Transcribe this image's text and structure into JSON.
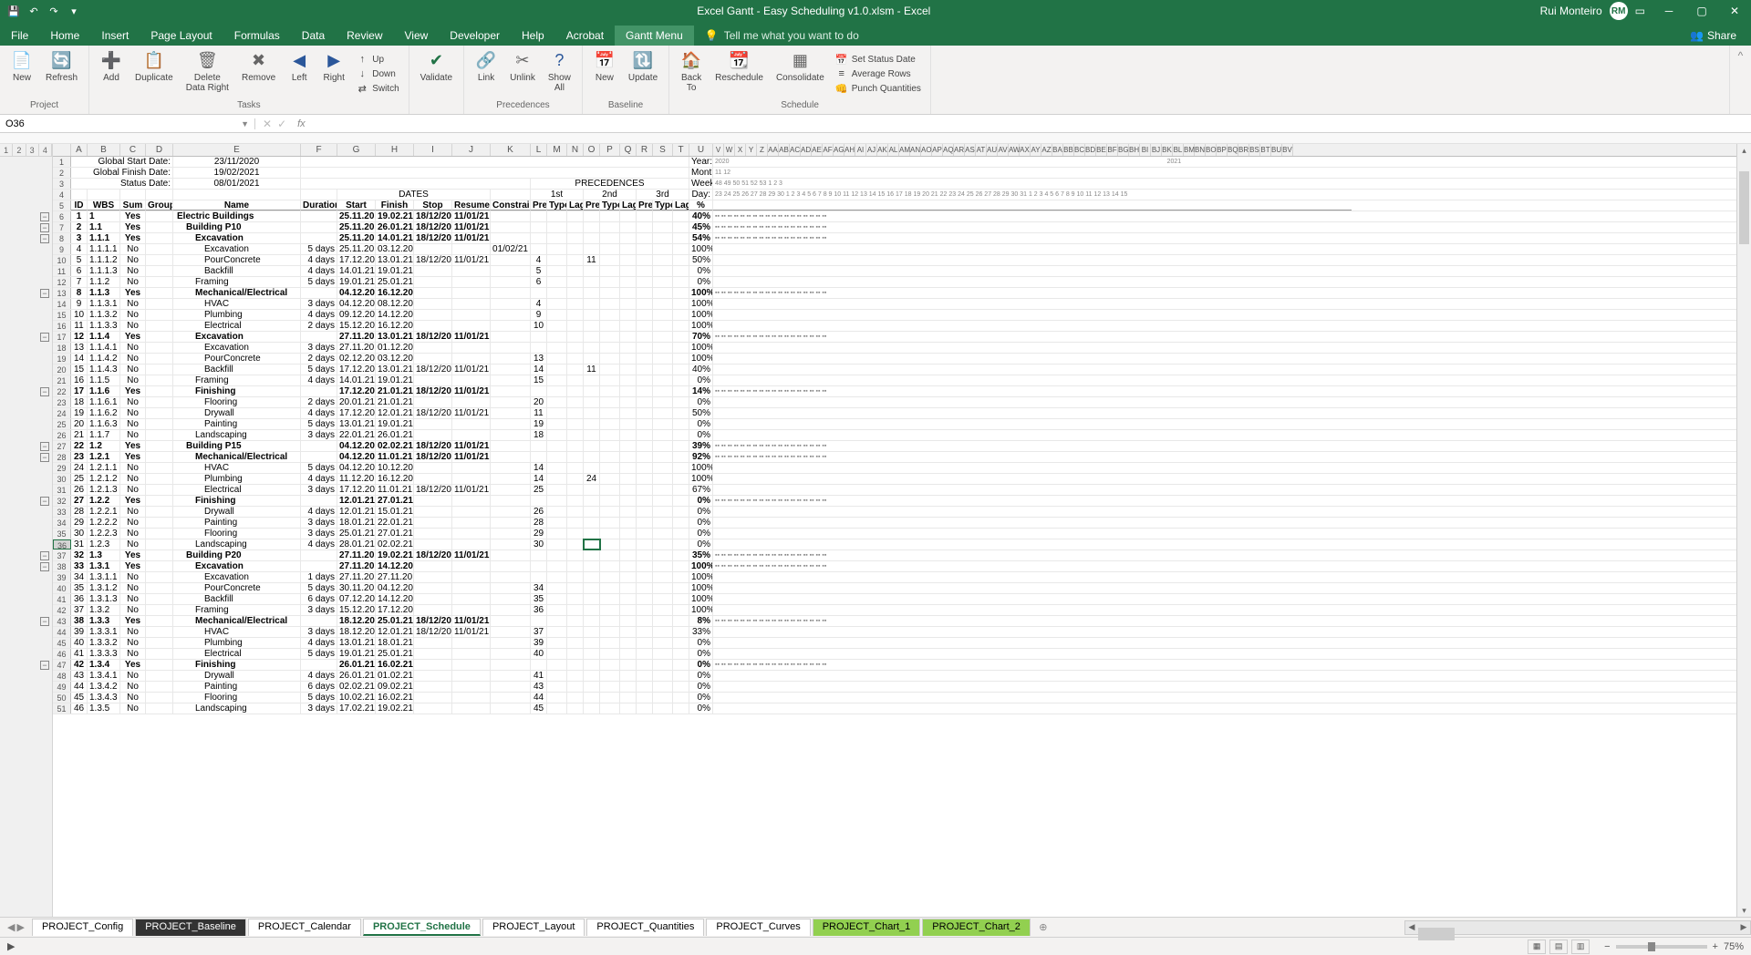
{
  "title": "Excel Gantt - Easy Scheduling v1.0.xlsm - Excel",
  "user": "Rui Monteiro",
  "tabs": [
    "File",
    "Home",
    "Insert",
    "Page Layout",
    "Formulas",
    "Data",
    "Review",
    "View",
    "Developer",
    "Help",
    "Acrobat",
    "Gantt Menu"
  ],
  "active_tab": "Gantt Menu",
  "tellme": "Tell me what you want to do",
  "share": "Share",
  "ribbon": {
    "groups": [
      {
        "name": "Project",
        "buttons": [
          {
            "icon": "📄",
            "label": "New"
          },
          {
            "icon": "🔄",
            "label": "Refresh",
            "color": "#217346"
          }
        ]
      },
      {
        "name": "Tasks",
        "buttons": [
          {
            "icon": "➕",
            "label": "Add"
          },
          {
            "icon": "📋",
            "label": "Duplicate"
          },
          {
            "icon": "🗑",
            "label": "Delete\nData Right"
          },
          {
            "icon": "✖",
            "label": "Remove"
          },
          {
            "icon": "◀",
            "label": "Left",
            "color": "#2b579a"
          },
          {
            "icon": "▶",
            "label": "Right",
            "color": "#2b579a"
          }
        ],
        "side": [
          {
            "icon": "↑",
            "label": "Up"
          },
          {
            "icon": "↓",
            "label": "Down"
          },
          {
            "icon": "⇄",
            "label": "Switch"
          }
        ]
      },
      {
        "name": "",
        "buttons": [
          {
            "icon": "✔",
            "label": "Validate",
            "color": "#217346"
          }
        ]
      },
      {
        "name": "Precedences",
        "buttons": [
          {
            "icon": "🔗",
            "label": "Link"
          },
          {
            "icon": "✂",
            "label": "Unlink"
          },
          {
            "icon": "?",
            "label": "Show\nAll",
            "color": "#2b579a"
          }
        ]
      },
      {
        "name": "Baseline",
        "buttons": [
          {
            "icon": "📅",
            "label": "New"
          },
          {
            "icon": "🔃",
            "label": "Update"
          }
        ]
      },
      {
        "name": "Schedule",
        "buttons": [
          {
            "icon": "🏠",
            "label": "Back\nTo"
          },
          {
            "icon": "📆",
            "label": "Reschedule"
          },
          {
            "icon": "▦",
            "label": "Consolidate"
          }
        ],
        "side": [
          {
            "icon": "📅",
            "label": "Set Status Date"
          },
          {
            "icon": "≡",
            "label": "Average Rows"
          },
          {
            "icon": "👊",
            "label": "Punch Quantities"
          }
        ]
      }
    ]
  },
  "namebox": "O36",
  "meta": {
    "global_start_label": "Global Start Date:",
    "global_start": "23/11/2020",
    "global_finish_label": "Global Finish Date:",
    "global_finish": "19/02/2021",
    "status_label": "Status Date:",
    "status": "08/01/2021",
    "year_label": "Year:",
    "year": "2020",
    "year2": "2021",
    "month_label": "Month:",
    "month": "11",
    "week_label": "Week:",
    "week": "48",
    "day_label": "Day:"
  },
  "col_hdrs": [
    "A",
    "B",
    "C",
    "D",
    "E",
    "F",
    "G",
    "H",
    "I",
    "J",
    "K",
    "L",
    "M",
    "N",
    "O",
    "P",
    "Q",
    "R",
    "S",
    "T",
    "U"
  ],
  "gantt_hdrs": [
    "V",
    "W",
    "X",
    "Y",
    "Z",
    "AA",
    "AB",
    "AC",
    "AD",
    "AE",
    "AF",
    "AG",
    "AH",
    "AI",
    "AJ",
    "AK",
    "AL",
    "AM",
    "AN",
    "AO",
    "AP",
    "AQ",
    "AR",
    "AS",
    "AT",
    "AU",
    "AV",
    "AW",
    "AX",
    "AY",
    "AZ",
    "BA",
    "BB",
    "BC",
    "BD",
    "BE",
    "BF",
    "BG",
    "BH",
    "BI",
    "BJ",
    "BK",
    "BL",
    "BM",
    "BN",
    "BO",
    "BP",
    "BQ",
    "BR",
    "BS",
    "BT",
    "BU",
    "BV"
  ],
  "headers": {
    "dates": "DATES",
    "prec": "PRECEDENCES",
    "id": "ID",
    "wbs": "WBS",
    "sum": "Sum",
    "group": "Group",
    "name": "Name",
    "duration": "Duration",
    "start": "Start",
    "finish": "Finish",
    "stop": "Stop",
    "resume": "Resume",
    "constraint": "Constraint",
    "pre": "Pre",
    "type": "Type",
    "lag": "Lag",
    "first": "1st",
    "second": "2nd",
    "third": "3rd",
    "pct": "%"
  },
  "weeks": [
    "48",
    "",
    "",
    "",
    "",
    "",
    "",
    "49",
    "",
    "",
    "",
    "",
    "",
    "",
    "50",
    "",
    "",
    "",
    "",
    "",
    "",
    "51",
    "",
    "",
    "",
    "",
    "",
    "",
    "52",
    "",
    "",
    "",
    "",
    "",
    "",
    "53",
    "",
    "",
    "",
    "",
    "",
    "",
    "1",
    "",
    "",
    "",
    "",
    "",
    "",
    "2",
    "",
    "",
    "",
    "",
    "",
    "",
    "3",
    ""
  ],
  "days": [
    "23",
    "24",
    "25",
    "26",
    "27",
    "28",
    "29",
    "30",
    "1",
    "2",
    "3",
    "4",
    "5",
    "6",
    "7",
    "8",
    "9",
    "10",
    "11",
    "12",
    "13",
    "14",
    "15",
    "16",
    "17",
    "18",
    "19",
    "20",
    "21",
    "22",
    "23",
    "24",
    "25",
    "26",
    "27",
    "28",
    "29",
    "30",
    "31",
    "1",
    "2",
    "3",
    "4",
    "5",
    "6",
    "7",
    "8",
    "9",
    "10",
    "11",
    "12",
    "13",
    "14",
    "15"
  ],
  "rows": [
    {
      "n": 6,
      "id": "1",
      "wbs": "1",
      "sum": "Yes",
      "name": "Electric Buildings",
      "b": 1,
      "start": "25.11.20",
      "finish": "19.02.21",
      "stop": "18/12/20",
      "resume": "11/01/21",
      "pct": "40%"
    },
    {
      "n": 7,
      "id": "2",
      "wbs": "1.1",
      "sum": "Yes",
      "name": "Building P10",
      "b": 1,
      "start": "25.11.20",
      "finish": "26.01.21",
      "stop": "18/12/20",
      "resume": "11/01/21",
      "pct": "45%"
    },
    {
      "n": 8,
      "id": "3",
      "wbs": "1.1.1",
      "sum": "Yes",
      "name": "Excavation",
      "b": 1,
      "start": "25.11.20",
      "finish": "14.01.21",
      "stop": "18/12/20",
      "resume": "11/01/21",
      "pct": "54%"
    },
    {
      "n": 9,
      "id": "4",
      "wbs": "1.1.1.1",
      "sum": "No",
      "name": "Excavation",
      "dur": "5 days",
      "start": "25.11.20",
      "finish": "03.12.20",
      "constraint": "01/02/21",
      "pct": "100%"
    },
    {
      "n": 10,
      "id": "5",
      "wbs": "1.1.1.2",
      "sum": "No",
      "name": "PourConcrete",
      "dur": "4 days",
      "start": "17.12.20",
      "finish": "13.01.21",
      "stop": "18/12/20",
      "resume": "11/01/21",
      "p1": "4",
      "p2": "11",
      "pct": "50%"
    },
    {
      "n": 11,
      "id": "6",
      "wbs": "1.1.1.3",
      "sum": "No",
      "name": "Backfill",
      "dur": "4 days",
      "start": "14.01.21",
      "finish": "19.01.21",
      "p1": "5",
      "pct": "0%"
    },
    {
      "n": 12,
      "id": "7",
      "wbs": "1.1.2",
      "sum": "No",
      "name": "Framing",
      "dur": "5 days",
      "start": "19.01.21",
      "finish": "25.01.21",
      "p1": "6",
      "pct": "0%"
    },
    {
      "n": 13,
      "id": "8",
      "wbs": "1.1.3",
      "sum": "Yes",
      "name": "Mechanical/Electrical",
      "b": 1,
      "start": "04.12.20",
      "finish": "16.12.20",
      "pct": "100%"
    },
    {
      "n": 14,
      "id": "9",
      "wbs": "1.1.3.1",
      "sum": "No",
      "name": "HVAC",
      "dur": "3 days",
      "start": "04.12.20",
      "finish": "08.12.20",
      "p1": "4",
      "pct": "100%"
    },
    {
      "n": 15,
      "id": "10",
      "wbs": "1.1.3.2",
      "sum": "No",
      "name": "Plumbing",
      "dur": "4 days",
      "start": "09.12.20",
      "finish": "14.12.20",
      "p1": "9",
      "pct": "100%"
    },
    {
      "n": 16,
      "id": "11",
      "wbs": "1.1.3.3",
      "sum": "No",
      "name": "Electrical",
      "dur": "2 days",
      "start": "15.12.20",
      "finish": "16.12.20",
      "p1": "10",
      "pct": "100%"
    },
    {
      "n": 17,
      "id": "12",
      "wbs": "1.1.4",
      "sum": "Yes",
      "name": "Excavation",
      "b": 1,
      "start": "27.11.20",
      "finish": "13.01.21",
      "stop": "18/12/20",
      "resume": "11/01/21",
      "pct": "70%"
    },
    {
      "n": 18,
      "id": "13",
      "wbs": "1.1.4.1",
      "sum": "No",
      "name": "Excavation",
      "dur": "3 days",
      "start": "27.11.20",
      "finish": "01.12.20",
      "pct": "100%"
    },
    {
      "n": 19,
      "id": "14",
      "wbs": "1.1.4.2",
      "sum": "No",
      "name": "PourConcrete",
      "dur": "2 days",
      "start": "02.12.20",
      "finish": "03.12.20",
      "p1": "13",
      "pct": "100%"
    },
    {
      "n": 20,
      "id": "15",
      "wbs": "1.1.4.3",
      "sum": "No",
      "name": "Backfill",
      "dur": "5 days",
      "start": "17.12.20",
      "finish": "13.01.21",
      "stop": "18/12/20",
      "resume": "11/01/21",
      "p1": "14",
      "p2": "11",
      "pct": "40%"
    },
    {
      "n": 21,
      "id": "16",
      "wbs": "1.1.5",
      "sum": "No",
      "name": "Framing",
      "dur": "4 days",
      "start": "14.01.21",
      "finish": "19.01.21",
      "p1": "15",
      "pct": "0%"
    },
    {
      "n": 22,
      "id": "17",
      "wbs": "1.1.6",
      "sum": "Yes",
      "name": "Finishing",
      "b": 1,
      "start": "17.12.20",
      "finish": "21.01.21",
      "stop": "18/12/20",
      "resume": "11/01/21",
      "pct": "14%"
    },
    {
      "n": 23,
      "id": "18",
      "wbs": "1.1.6.1",
      "sum": "No",
      "name": "Flooring",
      "dur": "2 days",
      "start": "20.01.21",
      "finish": "21.01.21",
      "p1": "20",
      "pct": "0%"
    },
    {
      "n": 24,
      "id": "19",
      "wbs": "1.1.6.2",
      "sum": "No",
      "name": "Drywall",
      "dur": "4 days",
      "start": "17.12.20",
      "finish": "12.01.21",
      "stop": "18/12/20",
      "resume": "11/01/21",
      "p1": "11",
      "pct": "50%"
    },
    {
      "n": 25,
      "id": "20",
      "wbs": "1.1.6.3",
      "sum": "No",
      "name": "Painting",
      "dur": "5 days",
      "start": "13.01.21",
      "finish": "19.01.21",
      "p1": "19",
      "pct": "0%"
    },
    {
      "n": 26,
      "id": "21",
      "wbs": "1.1.7",
      "sum": "No",
      "name": "Landscaping",
      "dur": "3 days",
      "start": "22.01.21",
      "finish": "26.01.21",
      "p1": "18",
      "pct": "0%"
    },
    {
      "n": 27,
      "id": "22",
      "wbs": "1.2",
      "sum": "Yes",
      "name": "Building P15",
      "b": 1,
      "start": "04.12.20",
      "finish": "02.02.21",
      "stop": "18/12/20",
      "resume": "11/01/21",
      "pct": "39%"
    },
    {
      "n": 28,
      "id": "23",
      "wbs": "1.2.1",
      "sum": "Yes",
      "name": "Mechanical/Electrical",
      "b": 1,
      "start": "04.12.20",
      "finish": "11.01.21",
      "stop": "18/12/20",
      "resume": "11/01/21",
      "pct": "92%"
    },
    {
      "n": 29,
      "id": "24",
      "wbs": "1.2.1.1",
      "sum": "No",
      "name": "HVAC",
      "dur": "5 days",
      "start": "04.12.20",
      "finish": "10.12.20",
      "p1": "14",
      "pct": "100%"
    },
    {
      "n": 30,
      "id": "25",
      "wbs": "1.2.1.2",
      "sum": "No",
      "name": "Plumbing",
      "dur": "4 days",
      "start": "11.12.20",
      "finish": "16.12.20",
      "p1": "14",
      "p2": "24",
      "pct": "100%"
    },
    {
      "n": 31,
      "id": "26",
      "wbs": "1.2.1.3",
      "sum": "No",
      "name": "Electrical",
      "dur": "3 days",
      "start": "17.12.20",
      "finish": "11.01.21",
      "stop": "18/12/20",
      "resume": "11/01/21",
      "p1": "25",
      "pct": "67%"
    },
    {
      "n": 32,
      "id": "27",
      "wbs": "1.2.2",
      "sum": "Yes",
      "name": "Finishing",
      "b": 1,
      "start": "12.01.21",
      "finish": "27.01.21",
      "pct": "0%"
    },
    {
      "n": 33,
      "id": "28",
      "wbs": "1.2.2.1",
      "sum": "No",
      "name": "Drywall",
      "dur": "4 days",
      "start": "12.01.21",
      "finish": "15.01.21",
      "p1": "26",
      "pct": "0%"
    },
    {
      "n": 34,
      "id": "29",
      "wbs": "1.2.2.2",
      "sum": "No",
      "name": "Painting",
      "dur": "3 days",
      "start": "18.01.21",
      "finish": "22.01.21",
      "p1": "28",
      "pct": "0%"
    },
    {
      "n": 35,
      "id": "30",
      "wbs": "1.2.2.3",
      "sum": "No",
      "name": "Flooring",
      "dur": "3 days",
      "start": "25.01.21",
      "finish": "27.01.21",
      "p1": "29",
      "pct": "0%"
    },
    {
      "n": 36,
      "id": "31",
      "wbs": "1.2.3",
      "sum": "No",
      "name": "Landscaping",
      "dur": "4 days",
      "start": "28.01.21",
      "finish": "02.02.21",
      "p1": "30",
      "pct": "0%",
      "sel": true
    },
    {
      "n": 37,
      "id": "32",
      "wbs": "1.3",
      "sum": "Yes",
      "name": "Building P20",
      "b": 1,
      "start": "27.11.20",
      "finish": "19.02.21",
      "stop": "18/12/20",
      "resume": "11/01/21",
      "pct": "35%"
    },
    {
      "n": 38,
      "id": "33",
      "wbs": "1.3.1",
      "sum": "Yes",
      "name": "Excavation",
      "b": 1,
      "start": "27.11.20",
      "finish": "14.12.20",
      "pct": "100%"
    },
    {
      "n": 39,
      "id": "34",
      "wbs": "1.3.1.1",
      "sum": "No",
      "name": "Excavation",
      "dur": "1 days",
      "start": "27.11.20",
      "finish": "27.11.20",
      "pct": "100%"
    },
    {
      "n": 40,
      "id": "35",
      "wbs": "1.3.1.2",
      "sum": "No",
      "name": "PourConcrete",
      "dur": "5 days",
      "start": "30.11.20",
      "finish": "04.12.20",
      "p1": "34",
      "pct": "100%"
    },
    {
      "n": 41,
      "id": "36",
      "wbs": "1.3.1.3",
      "sum": "No",
      "name": "Backfill",
      "dur": "6 days",
      "start": "07.12.20",
      "finish": "14.12.20",
      "p1": "35",
      "pct": "100%"
    },
    {
      "n": 42,
      "id": "37",
      "wbs": "1.3.2",
      "sum": "No",
      "name": "Framing",
      "dur": "3 days",
      "start": "15.12.20",
      "finish": "17.12.20",
      "p1": "36",
      "pct": "100%"
    },
    {
      "n": 43,
      "id": "38",
      "wbs": "1.3.3",
      "sum": "Yes",
      "name": "Mechanical/Electrical",
      "b": 1,
      "start": "18.12.20",
      "finish": "25.01.21",
      "stop": "18/12/20",
      "resume": "11/01/21",
      "pct": "8%"
    },
    {
      "n": 44,
      "id": "39",
      "wbs": "1.3.3.1",
      "sum": "No",
      "name": "HVAC",
      "dur": "3 days",
      "start": "18.12.20",
      "finish": "12.01.21",
      "stop": "18/12/20",
      "resume": "11/01/21",
      "p1": "37",
      "pct": "33%"
    },
    {
      "n": 45,
      "id": "40",
      "wbs": "1.3.3.2",
      "sum": "No",
      "name": "Plumbing",
      "dur": "4 days",
      "start": "13.01.21",
      "finish": "18.01.21",
      "p1": "39",
      "pct": "0%"
    },
    {
      "n": 46,
      "id": "41",
      "wbs": "1.3.3.3",
      "sum": "No",
      "name": "Electrical",
      "dur": "5 days",
      "start": "19.01.21",
      "finish": "25.01.21",
      "p1": "40",
      "pct": "0%"
    },
    {
      "n": 47,
      "id": "42",
      "wbs": "1.3.4",
      "sum": "Yes",
      "name": "Finishing",
      "b": 1,
      "start": "26.01.21",
      "finish": "16.02.21",
      "pct": "0%"
    },
    {
      "n": 48,
      "id": "43",
      "wbs": "1.3.4.1",
      "sum": "No",
      "name": "Drywall",
      "dur": "4 days",
      "start": "26.01.21",
      "finish": "01.02.21",
      "p1": "41",
      "pct": "0%"
    },
    {
      "n": 49,
      "id": "44",
      "wbs": "1.3.4.2",
      "sum": "No",
      "name": "Painting",
      "dur": "6 days",
      "start": "02.02.21",
      "finish": "09.02.21",
      "p1": "43",
      "pct": "0%"
    },
    {
      "n": 50,
      "id": "45",
      "wbs": "1.3.4.3",
      "sum": "No",
      "name": "Flooring",
      "dur": "5 days",
      "start": "10.02.21",
      "finish": "16.02.21",
      "p1": "44",
      "pct": "0%"
    },
    {
      "n": 51,
      "id": "46",
      "wbs": "1.3.5",
      "sum": "No",
      "name": "Landscaping",
      "dur": "3 days",
      "start": "17.02.21",
      "finish": "19.02.21",
      "p1": "45",
      "pct": "0%"
    }
  ],
  "sheets": [
    {
      "name": "PROJECT_Config"
    },
    {
      "name": "PROJECT_Baseline",
      "dark": true
    },
    {
      "name": "PROJECT_Calendar"
    },
    {
      "name": "PROJECT_Schedule",
      "active": true
    },
    {
      "name": "PROJECT_Layout"
    },
    {
      "name": "PROJECT_Quantities"
    },
    {
      "name": "PROJECT_Curves"
    },
    {
      "name": "PROJECT_Chart_1",
      "green": true
    },
    {
      "name": "PROJECT_Chart_2",
      "green": true
    }
  ],
  "zoom": "75%",
  "col_widths": {
    "rh": 20,
    "A": 18,
    "B": 36,
    "C": 28,
    "D": 30,
    "E": 140,
    "F": 40,
    "G": 42,
    "H": 42,
    "I": 42,
    "J": 42,
    "K": 44,
    "L": 18,
    "M": 22,
    "N": 18,
    "O": 18,
    "P": 22,
    "Q": 18,
    "R": 18,
    "S": 22,
    "T": 18,
    "U": 26
  }
}
